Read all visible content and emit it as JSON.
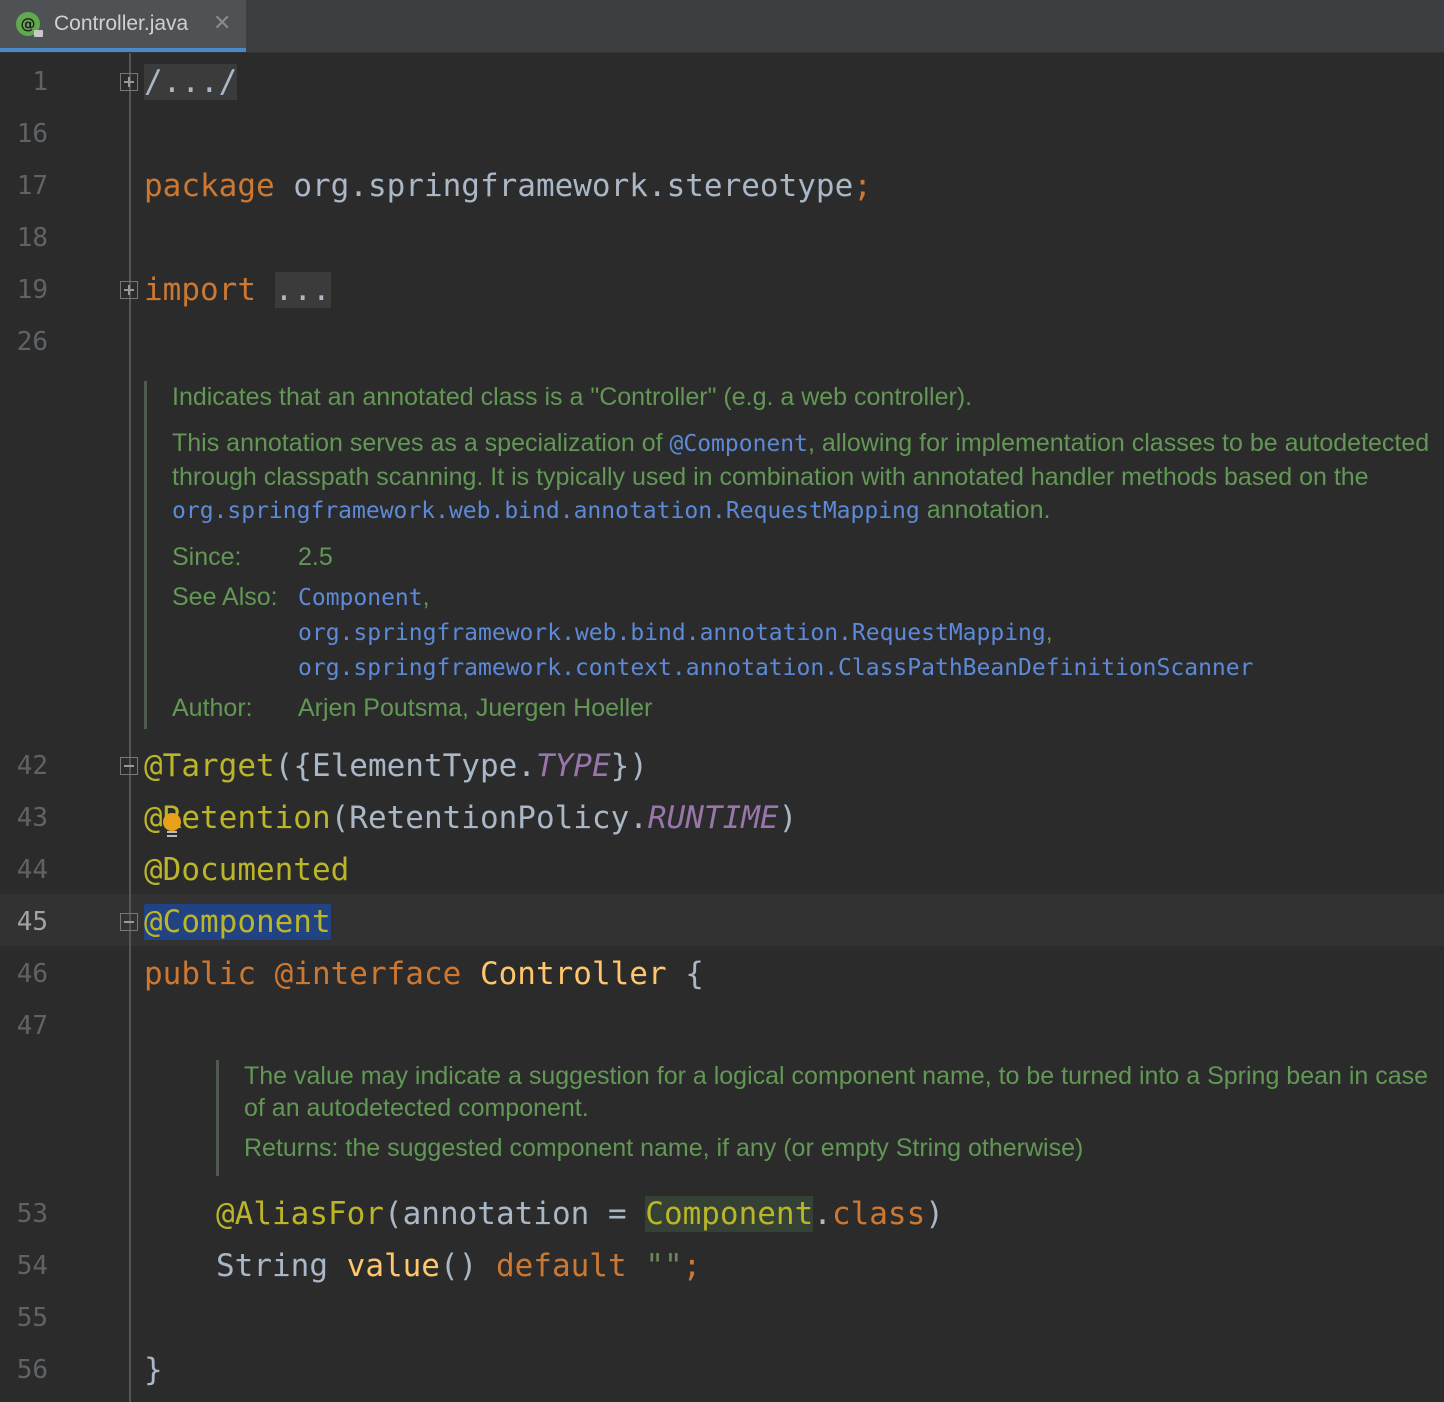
{
  "tab": {
    "title": "Controller.java",
    "icon": "@",
    "close": "✕"
  },
  "lines": {
    "l1": "1",
    "l16": "16",
    "l17": "17",
    "l18": "18",
    "l19": "19",
    "l26": "26",
    "l42": "42",
    "l43": "43",
    "l44": "44",
    "l45": "45",
    "l46": "46",
    "l47": "47",
    "l53": "53",
    "l54": "54",
    "l55": "55",
    "l56": "56"
  },
  "code": {
    "fold_header": "/.../",
    "package_kw": "package",
    "package_name": " org.springframework.stereotype",
    "semicolon": ";",
    "import_kw": "import",
    "import_fold": "...",
    "target_ann": "@Target",
    "target_open": "({ElementType.",
    "target_const": "TYPE",
    "target_close": "})",
    "retention_ann": "@Retention",
    "retention_open": "(RetentionPolicy.",
    "retention_const": "RUNTIME",
    "retention_close": ")",
    "documented_ann": "@Documented",
    "component_ann": "@Component",
    "public_kw": "public",
    "interface_kw": "@interface",
    "class_name": "Controller",
    "open_brace": "{",
    "aliasfor_ann": "@AliasFor",
    "aliasfor_open": "(annotation = ",
    "aliasfor_target": "Component",
    "aliasfor_dot": ".",
    "aliasfor_class": "class",
    "aliasfor_close": ")",
    "string_type": "String ",
    "method_name": "value",
    "parens": "() ",
    "default_kw": "default",
    "empty_string": "\"\"",
    "close_brace": "}"
  },
  "doc1": {
    "summary": "Indicates that an annotated class is a \"Controller\" (e.g. a web controller).",
    "para_a": "This annotation serves as a specialization of ",
    "para_link1": "@Component",
    "para_b": ", allowing for implementation classes to be autodetected through classpath scanning. It is typically used in combination with annotated handler methods based on the ",
    "para_link2": "org.springframework.web.bind.annotation.RequestMapping",
    "para_c": " annotation.",
    "since_label": "Since:",
    "since_value": "2.5",
    "see_label": "See Also:",
    "see_1": "Component",
    "see_2": "org.springframework.web.bind.annotation.RequestMapping",
    "see_3": "org.springframework.context.annotation.ClassPathBeanDefinitionScanner",
    "comma": ",",
    "author_label": "Author:",
    "author_value": "Arjen Poutsma, Juergen Hoeller"
  },
  "doc2": {
    "text": "The value may indicate a suggestion for a logical component name, to be turned into a Spring bean in case of an autodetected component.",
    "returns": "Returns: the suggested component name, if any (or empty String otherwise)"
  },
  "colors": {
    "background": "#2b2b2b",
    "keyword": "#cc7832",
    "annotation": "#bbb529",
    "doc": "#629755",
    "link": "#5c8ad8",
    "selection": "#214283"
  }
}
